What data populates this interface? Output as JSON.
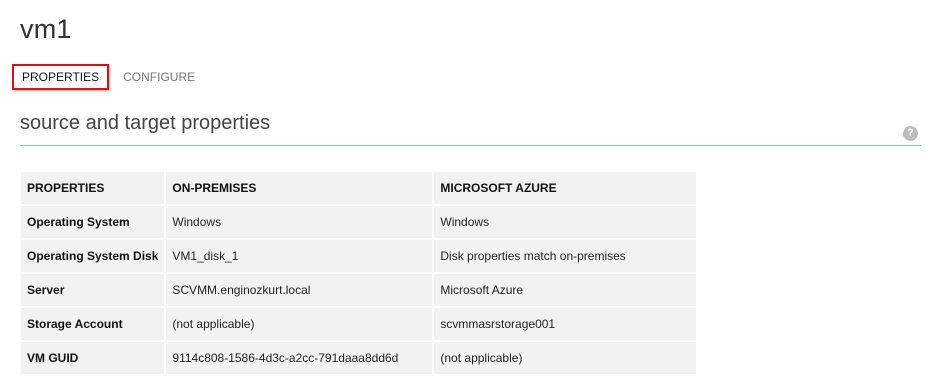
{
  "header": {
    "title": "vm1"
  },
  "tabs": [
    {
      "label": "PROPERTIES",
      "active": true
    },
    {
      "label": "CONFIGURE",
      "active": false
    }
  ],
  "section": {
    "title": "source and target properties",
    "help_icon": "question-icon"
  },
  "table": {
    "headers": [
      "PROPERTIES",
      "ON-PREMISES",
      "MICROSOFT AZURE"
    ],
    "rows": [
      [
        "Operating System",
        "Windows",
        "Windows"
      ],
      [
        "Operating System Disk",
        "VM1_disk_1",
        "Disk properties match on-premises"
      ],
      [
        "Server",
        "SCVMM.enginozkurt.local",
        "Microsoft Azure"
      ],
      [
        "Storage Account",
        "(not applicable)",
        "scvmmasrstorage001"
      ],
      [
        "VM GUID",
        "9114c808-1586-4d3c-a2cc-791daaa8dd6d",
        "(not applicable)"
      ]
    ]
  },
  "colors": {
    "active_tab_border": "#d0161b",
    "rule": "#8fb7d1",
    "cell_bg": "#f2f2f2"
  }
}
